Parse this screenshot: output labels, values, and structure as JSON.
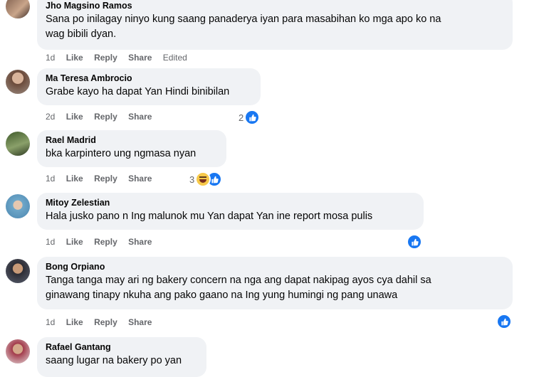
{
  "comments": [
    {
      "name": "Jho Magsino Ramos",
      "text_lines": [
        "Sana po inilagay ninyo kung saang panaderya iyan para masabihan ko mga apo ko na",
        "wag bibili dyan."
      ],
      "time": "1d",
      "like": "Like",
      "reply": "Reply",
      "share": "Share",
      "edited": "Edited"
    },
    {
      "name": "Ma Teresa Ambrocio",
      "text_lines": [
        "Grabe kayo ha dapat Yan Hindi binibilan"
      ],
      "time": "2d",
      "like": "Like",
      "reply": "Reply",
      "share": "Share",
      "reaction_count": "2"
    },
    {
      "name": "Rael Madrid",
      "text_lines": [
        "bka karpintero ung ngmasa nyan"
      ],
      "time": "1d",
      "like": "Like",
      "reply": "Reply",
      "share": "Share",
      "reaction_count": "3"
    },
    {
      "name": "Mitoy Zelestian",
      "text_lines": [
        "Hala jusko pano n Ing malunok mu Yan dapat Yan ine report mosa pulis"
      ],
      "time": "1d",
      "like": "Like",
      "reply": "Reply",
      "share": "Share"
    },
    {
      "name": "Bong Orpiano",
      "text_lines": [
        "Tanga tanga may ari ng bakery concern na nga ang dapat nakipag ayos cya dahil sa",
        "ginawang tinapy nkuha ang pako gaano na Ing yung humingi ng pang unawa"
      ],
      "time": "1d",
      "like": "Like",
      "reply": "Reply",
      "share": "Share"
    },
    {
      "name": "Rafael Gantang",
      "text_lines": [
        "saang lugar na bakery po yan"
      ]
    }
  ],
  "colors": {
    "bubble": "#f0f2f5",
    "like_blue": "#1877f2",
    "meta": "#65676b"
  }
}
